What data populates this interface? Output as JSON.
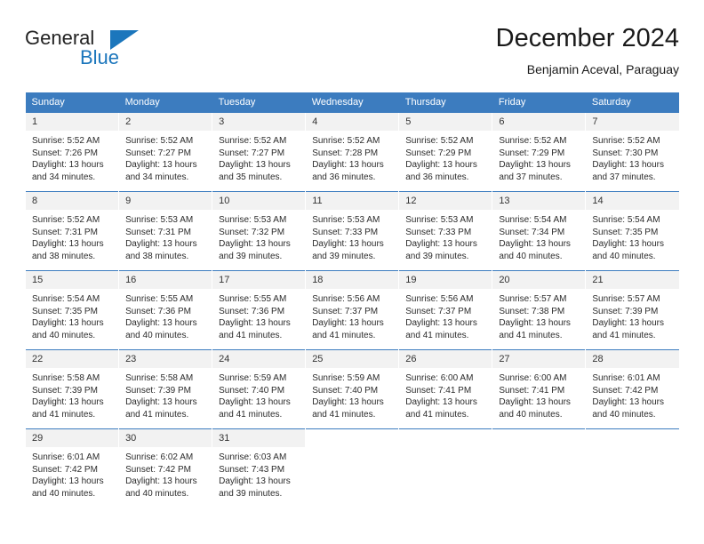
{
  "logo": {
    "line1": "General",
    "line2": "Blue",
    "accent_color": "#1b76bc",
    "triangle_icon": "triangle-icon"
  },
  "header": {
    "title": "December 2024",
    "subtitle": "Benjamin Aceval, Paraguay"
  },
  "calendar": {
    "header_bg": "#3c7cbf",
    "daynum_bg": "#f2f2f2",
    "weekdays": [
      "Sunday",
      "Monday",
      "Tuesday",
      "Wednesday",
      "Thursday",
      "Friday",
      "Saturday"
    ],
    "weeks": [
      [
        {
          "day": "1",
          "sunrise": "Sunrise: 5:52 AM",
          "sunset": "Sunset: 7:26 PM",
          "daylight": "Daylight: 13 hours and 34 minutes."
        },
        {
          "day": "2",
          "sunrise": "Sunrise: 5:52 AM",
          "sunset": "Sunset: 7:27 PM",
          "daylight": "Daylight: 13 hours and 34 minutes."
        },
        {
          "day": "3",
          "sunrise": "Sunrise: 5:52 AM",
          "sunset": "Sunset: 7:27 PM",
          "daylight": "Daylight: 13 hours and 35 minutes."
        },
        {
          "day": "4",
          "sunrise": "Sunrise: 5:52 AM",
          "sunset": "Sunset: 7:28 PM",
          "daylight": "Daylight: 13 hours and 36 minutes."
        },
        {
          "day": "5",
          "sunrise": "Sunrise: 5:52 AM",
          "sunset": "Sunset: 7:29 PM",
          "daylight": "Daylight: 13 hours and 36 minutes."
        },
        {
          "day": "6",
          "sunrise": "Sunrise: 5:52 AM",
          "sunset": "Sunset: 7:29 PM",
          "daylight": "Daylight: 13 hours and 37 minutes."
        },
        {
          "day": "7",
          "sunrise": "Sunrise: 5:52 AM",
          "sunset": "Sunset: 7:30 PM",
          "daylight": "Daylight: 13 hours and 37 minutes."
        }
      ],
      [
        {
          "day": "8",
          "sunrise": "Sunrise: 5:52 AM",
          "sunset": "Sunset: 7:31 PM",
          "daylight": "Daylight: 13 hours and 38 minutes."
        },
        {
          "day": "9",
          "sunrise": "Sunrise: 5:53 AM",
          "sunset": "Sunset: 7:31 PM",
          "daylight": "Daylight: 13 hours and 38 minutes."
        },
        {
          "day": "10",
          "sunrise": "Sunrise: 5:53 AM",
          "sunset": "Sunset: 7:32 PM",
          "daylight": "Daylight: 13 hours and 39 minutes."
        },
        {
          "day": "11",
          "sunrise": "Sunrise: 5:53 AM",
          "sunset": "Sunset: 7:33 PM",
          "daylight": "Daylight: 13 hours and 39 minutes."
        },
        {
          "day": "12",
          "sunrise": "Sunrise: 5:53 AM",
          "sunset": "Sunset: 7:33 PM",
          "daylight": "Daylight: 13 hours and 39 minutes."
        },
        {
          "day": "13",
          "sunrise": "Sunrise: 5:54 AM",
          "sunset": "Sunset: 7:34 PM",
          "daylight": "Daylight: 13 hours and 40 minutes."
        },
        {
          "day": "14",
          "sunrise": "Sunrise: 5:54 AM",
          "sunset": "Sunset: 7:35 PM",
          "daylight": "Daylight: 13 hours and 40 minutes."
        }
      ],
      [
        {
          "day": "15",
          "sunrise": "Sunrise: 5:54 AM",
          "sunset": "Sunset: 7:35 PM",
          "daylight": "Daylight: 13 hours and 40 minutes."
        },
        {
          "day": "16",
          "sunrise": "Sunrise: 5:55 AM",
          "sunset": "Sunset: 7:36 PM",
          "daylight": "Daylight: 13 hours and 40 minutes."
        },
        {
          "day": "17",
          "sunrise": "Sunrise: 5:55 AM",
          "sunset": "Sunset: 7:36 PM",
          "daylight": "Daylight: 13 hours and 41 minutes."
        },
        {
          "day": "18",
          "sunrise": "Sunrise: 5:56 AM",
          "sunset": "Sunset: 7:37 PM",
          "daylight": "Daylight: 13 hours and 41 minutes."
        },
        {
          "day": "19",
          "sunrise": "Sunrise: 5:56 AM",
          "sunset": "Sunset: 7:37 PM",
          "daylight": "Daylight: 13 hours and 41 minutes."
        },
        {
          "day": "20",
          "sunrise": "Sunrise: 5:57 AM",
          "sunset": "Sunset: 7:38 PM",
          "daylight": "Daylight: 13 hours and 41 minutes."
        },
        {
          "day": "21",
          "sunrise": "Sunrise: 5:57 AM",
          "sunset": "Sunset: 7:39 PM",
          "daylight": "Daylight: 13 hours and 41 minutes."
        }
      ],
      [
        {
          "day": "22",
          "sunrise": "Sunrise: 5:58 AM",
          "sunset": "Sunset: 7:39 PM",
          "daylight": "Daylight: 13 hours and 41 minutes."
        },
        {
          "day": "23",
          "sunrise": "Sunrise: 5:58 AM",
          "sunset": "Sunset: 7:39 PM",
          "daylight": "Daylight: 13 hours and 41 minutes."
        },
        {
          "day": "24",
          "sunrise": "Sunrise: 5:59 AM",
          "sunset": "Sunset: 7:40 PM",
          "daylight": "Daylight: 13 hours and 41 minutes."
        },
        {
          "day": "25",
          "sunrise": "Sunrise: 5:59 AM",
          "sunset": "Sunset: 7:40 PM",
          "daylight": "Daylight: 13 hours and 41 minutes."
        },
        {
          "day": "26",
          "sunrise": "Sunrise: 6:00 AM",
          "sunset": "Sunset: 7:41 PM",
          "daylight": "Daylight: 13 hours and 41 minutes."
        },
        {
          "day": "27",
          "sunrise": "Sunrise: 6:00 AM",
          "sunset": "Sunset: 7:41 PM",
          "daylight": "Daylight: 13 hours and 40 minutes."
        },
        {
          "day": "28",
          "sunrise": "Sunrise: 6:01 AM",
          "sunset": "Sunset: 7:42 PM",
          "daylight": "Daylight: 13 hours and 40 minutes."
        }
      ],
      [
        {
          "day": "29",
          "sunrise": "Sunrise: 6:01 AM",
          "sunset": "Sunset: 7:42 PM",
          "daylight": "Daylight: 13 hours and 40 minutes."
        },
        {
          "day": "30",
          "sunrise": "Sunrise: 6:02 AM",
          "sunset": "Sunset: 7:42 PM",
          "daylight": "Daylight: 13 hours and 40 minutes."
        },
        {
          "day": "31",
          "sunrise": "Sunrise: 6:03 AM",
          "sunset": "Sunset: 7:43 PM",
          "daylight": "Daylight: 13 hours and 39 minutes."
        },
        {
          "day": "",
          "sunrise": "",
          "sunset": "",
          "daylight": ""
        },
        {
          "day": "",
          "sunrise": "",
          "sunset": "",
          "daylight": ""
        },
        {
          "day": "",
          "sunrise": "",
          "sunset": "",
          "daylight": ""
        },
        {
          "day": "",
          "sunrise": "",
          "sunset": "",
          "daylight": ""
        }
      ]
    ]
  }
}
